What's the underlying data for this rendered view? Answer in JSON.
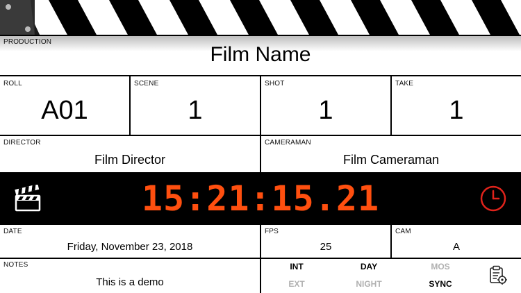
{
  "production": {
    "label": "PRODUCTION",
    "value": "Film Name"
  },
  "roll": {
    "label": "ROLL",
    "value": "A01"
  },
  "scene": {
    "label": "SCENE",
    "value": "1"
  },
  "shot": {
    "label": "SHOT",
    "value": "1"
  },
  "take": {
    "label": "TAKE",
    "value": "1"
  },
  "director": {
    "label": "DIRECTOR",
    "value": "Film Director"
  },
  "cameraman": {
    "label": "CAMERAMAN",
    "value": "Film Cameraman"
  },
  "timecode": {
    "value": "15:21:15.21",
    "color": "#ff4f0f"
  },
  "date": {
    "label": "DATE",
    "value": "Friday, November 23, 2018"
  },
  "fps": {
    "label": "FPS",
    "value": "25"
  },
  "cam": {
    "label": "CAM",
    "value": "A"
  },
  "notes": {
    "label": "NOTES",
    "value": "This is a demo"
  },
  "toggles": {
    "int": {
      "label": "INT",
      "active": true
    },
    "day": {
      "label": "DAY",
      "active": true
    },
    "mos": {
      "label": "MOS",
      "active": false
    },
    "ext": {
      "label": "EXT",
      "active": false
    },
    "night": {
      "label": "NIGHT",
      "active": false
    },
    "sync": {
      "label": "SYNC",
      "active": true
    }
  },
  "icons": {
    "slate": "clapperboard-icon",
    "clock": "clock-icon",
    "settings": "clipboard-gear-icon"
  },
  "colors": {
    "accent": "#e0231b",
    "background": "#000000"
  }
}
